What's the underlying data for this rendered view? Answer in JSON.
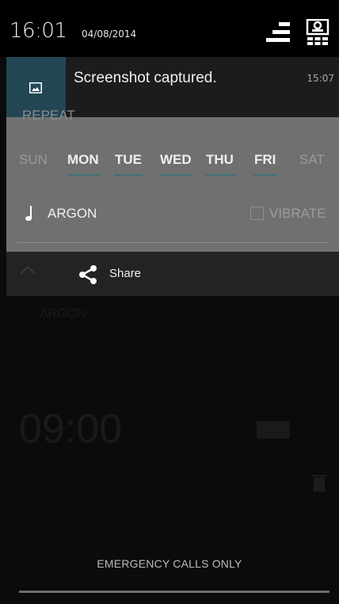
{
  "status_bar": {
    "time": "16:01",
    "date": "04/08/2014",
    "icons": [
      "quick-settings-icon",
      "settings-tile-icon"
    ]
  },
  "notification": {
    "icon": "image-icon",
    "title": "Screenshot captured.",
    "time": "15:07"
  },
  "alarm_panel": {
    "repeat_label": "REPEAT",
    "days": [
      {
        "label": "SUN",
        "active": false
      },
      {
        "label": "MON",
        "active": true
      },
      {
        "label": "TUE",
        "active": true
      },
      {
        "label": "WED",
        "active": true
      },
      {
        "label": "THU",
        "active": true
      },
      {
        "label": "FRI",
        "active": true
      },
      {
        "label": "SAT",
        "active": false
      }
    ],
    "ringtone": "ARGON",
    "vibrate_label": "VIBRATE"
  },
  "share_bar": {
    "label": "Share"
  },
  "background": {
    "ghost_ringtone": "ARGON",
    "ghost_time": "09:00"
  },
  "lockscreen": {
    "emergency": "EMERGENCY CALLS ONLY"
  },
  "colors": {
    "notification_accent": "#234654",
    "day_underline": "#3f6f7a"
  }
}
